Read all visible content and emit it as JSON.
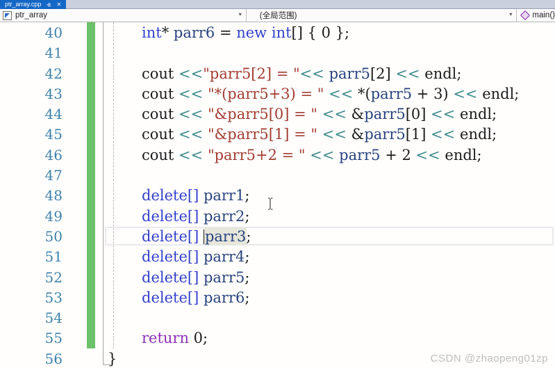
{
  "tab": {
    "title": "ptr_array.cpp",
    "close_glyph": "✕"
  },
  "navbar": {
    "project_label": "ptr_array",
    "scope_label": "(全局范围)",
    "member_label": "main()",
    "dropdown_glyph": "▾"
  },
  "editor": {
    "current_line": 50,
    "change_bar": {
      "from_line": 40,
      "to_line": 55
    },
    "highlighted_symbol": "parr3",
    "lines": [
      {
        "n": 40,
        "tokens": [
          [
            "kw",
            "int"
          ],
          [
            "pl",
            "* "
          ],
          [
            "var",
            "parr6"
          ],
          [
            "pl",
            " = "
          ],
          [
            "kw",
            "new"
          ],
          [
            "pl",
            " "
          ],
          [
            "kw",
            "int"
          ],
          [
            "pl",
            "[] { 0 };"
          ]
        ]
      },
      {
        "n": 41,
        "tokens": []
      },
      {
        "n": 42,
        "tokens": [
          [
            "pl",
            "cout "
          ],
          [
            "op",
            "<<"
          ],
          [
            "str",
            "\"parr5[2] = \""
          ],
          [
            "op",
            "<<"
          ],
          [
            "pl",
            " "
          ],
          [
            "var",
            "parr5"
          ],
          [
            "pl",
            "[2] "
          ],
          [
            "op",
            "<<"
          ],
          [
            "pl",
            " endl;"
          ]
        ]
      },
      {
        "n": 43,
        "tokens": [
          [
            "pl",
            "cout "
          ],
          [
            "op",
            "<<"
          ],
          [
            "pl",
            " "
          ],
          [
            "str",
            "\"*(parr5+3) = \""
          ],
          [
            "pl",
            " "
          ],
          [
            "op",
            "<<"
          ],
          [
            "pl",
            " *("
          ],
          [
            "var",
            "parr5"
          ],
          [
            "pl",
            " + 3) "
          ],
          [
            "op",
            "<<"
          ],
          [
            "pl",
            " endl;"
          ]
        ]
      },
      {
        "n": 44,
        "tokens": [
          [
            "pl",
            "cout "
          ],
          [
            "op",
            "<<"
          ],
          [
            "pl",
            " "
          ],
          [
            "str",
            "\"&parr5[0] = \""
          ],
          [
            "pl",
            " "
          ],
          [
            "op",
            "<<"
          ],
          [
            "pl",
            " &"
          ],
          [
            "var",
            "parr5"
          ],
          [
            "pl",
            "[0] "
          ],
          [
            "op",
            "<<"
          ],
          [
            "pl",
            " endl;"
          ]
        ]
      },
      {
        "n": 45,
        "tokens": [
          [
            "pl",
            "cout "
          ],
          [
            "op",
            "<<"
          ],
          [
            "pl",
            " "
          ],
          [
            "str",
            "\"&parr5[1] = \""
          ],
          [
            "pl",
            " "
          ],
          [
            "op",
            "<<"
          ],
          [
            "pl",
            " &"
          ],
          [
            "var",
            "parr5"
          ],
          [
            "pl",
            "[1] "
          ],
          [
            "op",
            "<<"
          ],
          [
            "pl",
            " endl;"
          ]
        ]
      },
      {
        "n": 46,
        "tokens": [
          [
            "pl",
            "cout "
          ],
          [
            "op",
            "<<"
          ],
          [
            "pl",
            " "
          ],
          [
            "str",
            "\"parr5+2 = \""
          ],
          [
            "pl",
            " "
          ],
          [
            "op",
            "<<"
          ],
          [
            "pl",
            " "
          ],
          [
            "var",
            "parr5"
          ],
          [
            "pl",
            " + 2 "
          ],
          [
            "op",
            "<<"
          ],
          [
            "pl",
            " endl;"
          ]
        ]
      },
      {
        "n": 47,
        "tokens": []
      },
      {
        "n": 48,
        "tokens": [
          [
            "kw",
            "delete[]"
          ],
          [
            "pl",
            " "
          ],
          [
            "var",
            "parr1"
          ],
          [
            "pl",
            ";"
          ]
        ]
      },
      {
        "n": 49,
        "tokens": [
          [
            "kw",
            "delete[]"
          ],
          [
            "pl",
            " "
          ],
          [
            "var",
            "parr2"
          ],
          [
            "pl",
            ";"
          ]
        ]
      },
      {
        "n": 50,
        "tokens": [
          [
            "kw",
            "delete[]"
          ],
          [
            "pl",
            " "
          ],
          [
            "caret",
            ""
          ],
          [
            "varhl",
            "parr3"
          ],
          [
            "pl",
            ";"
          ]
        ]
      },
      {
        "n": 51,
        "tokens": [
          [
            "kw",
            "delete[]"
          ],
          [
            "pl",
            " "
          ],
          [
            "var",
            "parr4"
          ],
          [
            "pl",
            ";"
          ]
        ]
      },
      {
        "n": 52,
        "tokens": [
          [
            "kw",
            "delete[]"
          ],
          [
            "pl",
            " "
          ],
          [
            "var",
            "parr5"
          ],
          [
            "pl",
            ";"
          ]
        ]
      },
      {
        "n": 53,
        "tokens": [
          [
            "kw",
            "delete[]"
          ],
          [
            "pl",
            " "
          ],
          [
            "var",
            "parr6"
          ],
          [
            "pl",
            ";"
          ]
        ]
      },
      {
        "n": 54,
        "tokens": []
      },
      {
        "n": 55,
        "tokens": [
          [
            "ctrl",
            "return"
          ],
          [
            "pl",
            " 0;"
          ]
        ]
      },
      {
        "n": 56,
        "brace": true,
        "tokens": [
          [
            "pl",
            "}"
          ]
        ]
      }
    ]
  },
  "watermark": "CSDN @zhaopeng01zp",
  "colors": {
    "active_tab": "#1467c5",
    "tab_strip_background": "#c9cfdd",
    "keyword": "#3341cc",
    "control_keyword": "#8e2eba",
    "string": "#a33c31",
    "operator": "#3e8b8b",
    "local_variable": "#27427f",
    "line_number": "#3e82ab",
    "change_bar_green": "#6cc26a",
    "reference_highlight": "#e6e6db"
  }
}
